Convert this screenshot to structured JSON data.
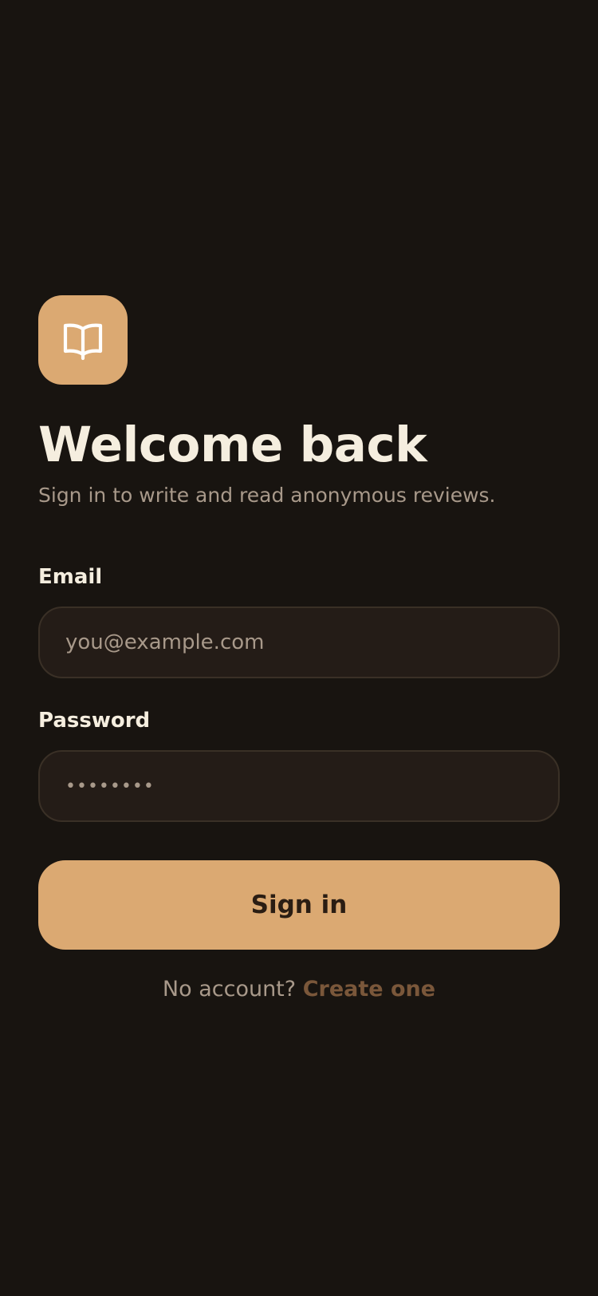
{
  "app": {
    "logo_icon": "open-book-icon",
    "accent_color": "#DBA972",
    "background_color": "#181410"
  },
  "header": {
    "title": "Welcome back",
    "subtitle": "Sign in to write and read anonymous reviews."
  },
  "form": {
    "email": {
      "label": "Email",
      "placeholder": "you@example.com",
      "value": ""
    },
    "password": {
      "label": "Password",
      "value": "••••••••"
    },
    "submit_label": "Sign in"
  },
  "footer": {
    "prompt": "No account?",
    "link_label": "Create one"
  }
}
